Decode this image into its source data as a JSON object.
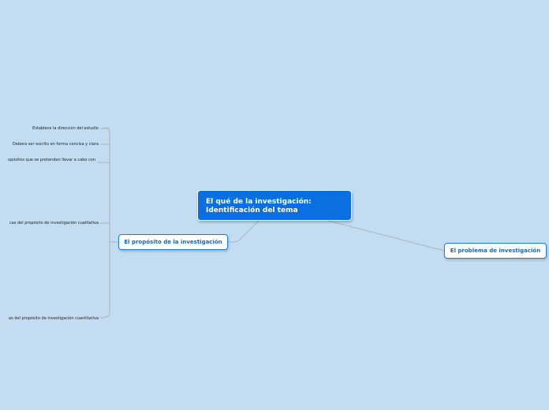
{
  "map": {
    "central_topic": {
      "line1": "El qué de la investigación:",
      "line2": "Identificación del tema"
    },
    "main_topics": {
      "proposito": "El propósito de la investigación",
      "problema": "El problema de investigación"
    },
    "subtopics": [
      "Establece la dirección del estudio",
      "Debera ser escrito en forma concisa y clara",
      "opósitos que se pretenden llevar a cabo con",
      "cas del propósito de investigación cualitativa",
      "as del propósito de investigación cuantitativa"
    ]
  },
  "colors": {
    "background": "#c2ddf1",
    "central_fill": "#0a6fe0",
    "topic_border": "#1c7de6",
    "topic_text": "#1467c2",
    "connector": "#a9b4bd"
  }
}
